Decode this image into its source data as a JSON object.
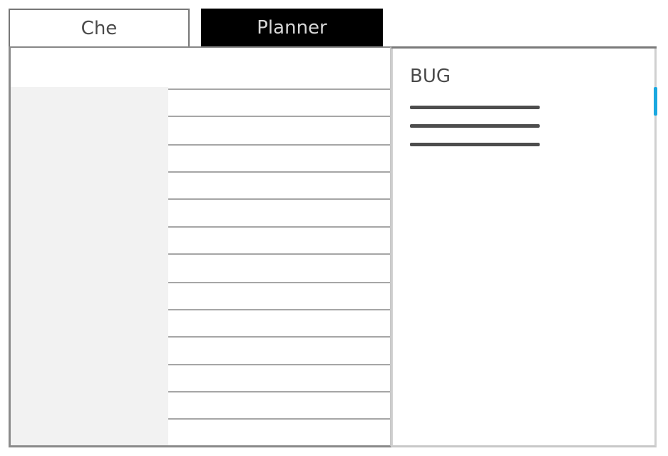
{
  "tabs": [
    {
      "label": "Che",
      "active": false
    },
    {
      "label": "Planner",
      "active": true
    }
  ],
  "list": {
    "row_count": 13,
    "rows": [
      "",
      "",
      "",
      "",
      "",
      "",
      "",
      "",
      "",
      "",
      "",
      "",
      ""
    ]
  },
  "panel": {
    "title": "BUG",
    "menu_icon": "hamburger-menu-icon"
  },
  "colors": {
    "active_tab_bg": "#000000",
    "active_tab_text": "#d6d6d6",
    "sidepane_bg": "#f2f2f2",
    "scroll_accent": "#1aa8e0"
  }
}
